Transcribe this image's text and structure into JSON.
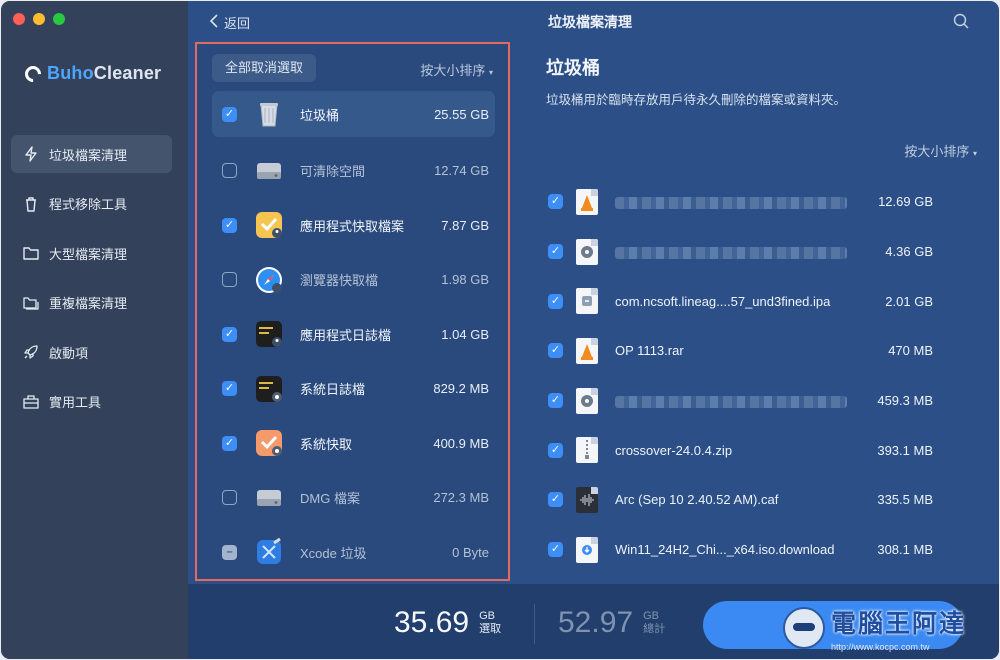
{
  "window": {
    "title": "垃圾檔案清理",
    "back_label": "返回"
  },
  "brand": {
    "name_part1": "Buho",
    "name_part2": "Cleaner"
  },
  "sidebar": {
    "items": [
      {
        "label": "垃圾檔案清理",
        "icon": "bolt-icon",
        "active": true
      },
      {
        "label": "程式移除工具",
        "icon": "trash-icon",
        "active": false
      },
      {
        "label": "大型檔案清理",
        "icon": "folder-icon",
        "active": false
      },
      {
        "label": "重複檔案清理",
        "icon": "duplicate-folder-icon",
        "active": false
      },
      {
        "label": "啟動項",
        "icon": "rocket-icon",
        "active": false
      },
      {
        "label": "實用工具",
        "icon": "toolbox-icon",
        "active": false
      }
    ]
  },
  "categories": {
    "deselect_all": "全部取消選取",
    "sort_label": "按大小排序",
    "items": [
      {
        "name": "垃圾桶",
        "size": "25.55 GB",
        "checked": "on",
        "icon": "trash-bin-icon",
        "selected": true
      },
      {
        "name": "可清除空間",
        "size": "12.74 GB",
        "checked": "off",
        "icon": "drive-icon",
        "selected": false
      },
      {
        "name": "應用程式快取檔案",
        "size": "7.87 GB",
        "checked": "on",
        "icon": "app-cache-icon",
        "selected": false
      },
      {
        "name": "瀏覽器快取檔",
        "size": "1.98 GB",
        "checked": "off",
        "icon": "browser-icon",
        "selected": false
      },
      {
        "name": "應用程式日誌檔",
        "size": "1.04 GB",
        "checked": "on",
        "icon": "app-log-icon",
        "selected": false
      },
      {
        "name": "系統日誌檔",
        "size": "829.2 MB",
        "checked": "on",
        "icon": "system-log-icon",
        "selected": false
      },
      {
        "name": "系統快取",
        "size": "400.9 MB",
        "checked": "on",
        "icon": "system-cache-icon",
        "selected": false
      },
      {
        "name": "DMG 檔案",
        "size": "272.3 MB",
        "checked": "off",
        "icon": "dmg-drive-icon",
        "selected": false
      },
      {
        "name": "Xcode 垃圾",
        "size": "0 Byte",
        "checked": "mixed",
        "icon": "xcode-icon",
        "selected": false
      }
    ]
  },
  "detail": {
    "title": "垃圾桶",
    "description": "垃圾桶用於臨時存放用戶待永久刪除的檔案或資料夾。",
    "sort_label": "按大小排序",
    "files": [
      {
        "name": "",
        "blurred": true,
        "size": "12.69 GB",
        "icon": "vlc-file-icon"
      },
      {
        "name": "",
        "blurred": true,
        "size": "4.36 GB",
        "icon": "disc-image-file-icon"
      },
      {
        "name": "com.ncsoft.lineag....57_und3fined.ipa",
        "blurred": false,
        "size": "2.01 GB",
        "icon": "ipa-file-icon"
      },
      {
        "name": "OP 1113.rar",
        "blurred": false,
        "size": "470 MB",
        "icon": "vlc-file-icon"
      },
      {
        "name": "",
        "blurred": true,
        "size": "459.3 MB",
        "icon": "disc-image-file-icon"
      },
      {
        "name": "crossover-24.0.4.zip",
        "blurred": false,
        "size": "393.1 MB",
        "icon": "zip-file-icon"
      },
      {
        "name": "Arc (Sep 10 2.40.52 AM).caf",
        "blurred": false,
        "size": "335.5 MB",
        "icon": "audio-file-icon"
      },
      {
        "name": "Win11_24H2_Chi..._x64.iso.download",
        "blurred": false,
        "size": "308.1 MB",
        "icon": "download-file-icon"
      }
    ]
  },
  "summary": {
    "selected_value": "35.69",
    "selected_unit": "GB",
    "selected_label": "選取",
    "total_value": "52.97",
    "total_unit": "GB",
    "total_label": "總計"
  },
  "watermark": {
    "title": "電腦王阿達",
    "url": "http://www.kocpc.com.tw"
  },
  "colors": {
    "accent": "#3b8af3",
    "highlight_border": "#e26a60",
    "sidebar_bg": "#33425a",
    "main_bg": "#2b4f86"
  }
}
